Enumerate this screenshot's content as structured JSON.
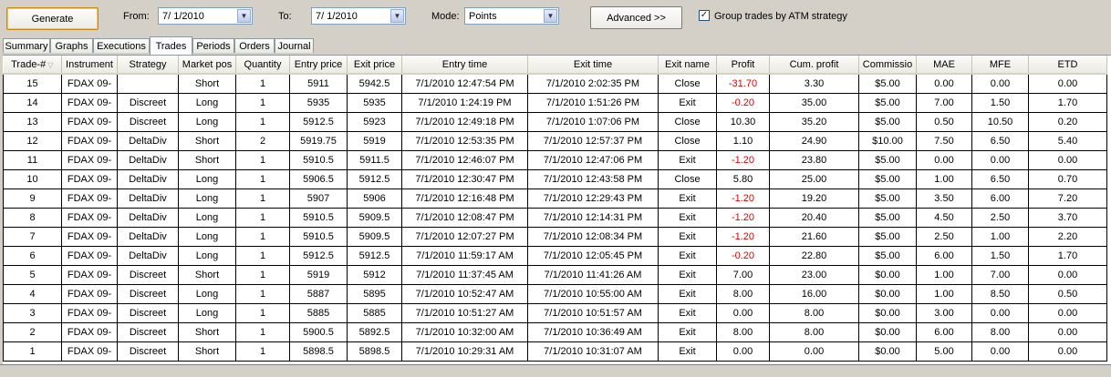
{
  "toolbar": {
    "generate_label": "Generate",
    "from_label": "From:",
    "from_value": "7/ 1/2010",
    "to_label": "To:",
    "to_value": "7/ 1/2010",
    "mode_label": "Mode:",
    "mode_value": "Points",
    "advanced_label": "Advanced >>",
    "group_checkbox_label": "Group trades by ATM strategy",
    "group_checked": "✓"
  },
  "tabs": [
    "Summary",
    "Graphs",
    "Executions",
    "Trades",
    "Periods",
    "Orders",
    "Journal"
  ],
  "active_tab": "Trades",
  "table": {
    "columns": [
      "Trade-#",
      "Instrument",
      "Strategy",
      "Market pos",
      "Quantity",
      "Entry price",
      "Exit price",
      "Entry time",
      "Exit time",
      "Exit name",
      "Profit",
      "Cum. profit",
      "Commissio",
      "MAE",
      "MFE",
      "ETD"
    ],
    "rows": [
      [
        "15",
        "FDAX 09-",
        "",
        "Short",
        "1",
        "5911",
        "5942.5",
        "7/1/2010 12:47:54 PM",
        "7/1/2010 2:02:35 PM",
        "Close",
        "-31.70",
        "3.30",
        "$5.00",
        "0.00",
        "0.00",
        "0.00"
      ],
      [
        "14",
        "FDAX 09-",
        "Discreet",
        "Long",
        "1",
        "5935",
        "5935",
        "7/1/2010 1:24:19 PM",
        "7/1/2010 1:51:26 PM",
        "Exit",
        "-0.20",
        "35.00",
        "$5.00",
        "7.00",
        "1.50",
        "1.70"
      ],
      [
        "13",
        "FDAX 09-",
        "Discreet",
        "Long",
        "1",
        "5912.5",
        "5923",
        "7/1/2010 12:49:18 PM",
        "7/1/2010 1:07:06 PM",
        "Close",
        "10.30",
        "35.20",
        "$5.00",
        "0.50",
        "10.50",
        "0.20"
      ],
      [
        "12",
        "FDAX 09-",
        "DeltaDiv",
        "Short",
        "2",
        "5919.75",
        "5919",
        "7/1/2010 12:53:35 PM",
        "7/1/2010 12:57:37 PM",
        "Close",
        "1.10",
        "24.90",
        "$10.00",
        "7.50",
        "6.50",
        "5.40"
      ],
      [
        "11",
        "FDAX 09-",
        "DeltaDiv",
        "Short",
        "1",
        "5910.5",
        "5911.5",
        "7/1/2010 12:46:07 PM",
        "7/1/2010 12:47:06 PM",
        "Exit",
        "-1.20",
        "23.80",
        "$5.00",
        "0.00",
        "0.00",
        "0.00"
      ],
      [
        "10",
        "FDAX 09-",
        "DeltaDiv",
        "Long",
        "1",
        "5906.5",
        "5912.5",
        "7/1/2010 12:30:47 PM",
        "7/1/2010 12:43:58 PM",
        "Close",
        "5.80",
        "25.00",
        "$5.00",
        "1.00",
        "6.50",
        "0.70"
      ],
      [
        "9",
        "FDAX 09-",
        "DeltaDiv",
        "Long",
        "1",
        "5907",
        "5906",
        "7/1/2010 12:16:48 PM",
        "7/1/2010 12:29:43 PM",
        "Exit",
        "-1.20",
        "19.20",
        "$5.00",
        "3.50",
        "6.00",
        "7.20"
      ],
      [
        "8",
        "FDAX 09-",
        "DeltaDiv",
        "Long",
        "1",
        "5910.5",
        "5909.5",
        "7/1/2010 12:08:47 PM",
        "7/1/2010 12:14:31 PM",
        "Exit",
        "-1.20",
        "20.40",
        "$5.00",
        "4.50",
        "2.50",
        "3.70"
      ],
      [
        "7",
        "FDAX 09-",
        "DeltaDiv",
        "Long",
        "1",
        "5910.5",
        "5909.5",
        "7/1/2010 12:07:27 PM",
        "7/1/2010 12:08:34 PM",
        "Exit",
        "-1.20",
        "21.60",
        "$5.00",
        "2.50",
        "1.00",
        "2.20"
      ],
      [
        "6",
        "FDAX 09-",
        "DeltaDiv",
        "Long",
        "1",
        "5912.5",
        "5912.5",
        "7/1/2010 11:59:17 AM",
        "7/1/2010 12:05:45 PM",
        "Exit",
        "-0.20",
        "22.80",
        "$5.00",
        "6.00",
        "1.50",
        "1.70"
      ],
      [
        "5",
        "FDAX 09-",
        "Discreet",
        "Short",
        "1",
        "5919",
        "5912",
        "7/1/2010 11:37:45 AM",
        "7/1/2010 11:41:26 AM",
        "Exit",
        "7.00",
        "23.00",
        "$0.00",
        "1.00",
        "7.00",
        "0.00"
      ],
      [
        "4",
        "FDAX 09-",
        "Discreet",
        "Long",
        "1",
        "5887",
        "5895",
        "7/1/2010 10:52:47 AM",
        "7/1/2010 10:55:00 AM",
        "Exit",
        "8.00",
        "16.00",
        "$0.00",
        "1.00",
        "8.50",
        "0.50"
      ],
      [
        "3",
        "FDAX 09-",
        "Discreet",
        "Long",
        "1",
        "5885",
        "5885",
        "7/1/2010 10:51:27 AM",
        "7/1/2010 10:51:57 AM",
        "Exit",
        "0.00",
        "8.00",
        "$0.00",
        "3.00",
        "0.00",
        "0.00"
      ],
      [
        "2",
        "FDAX 09-",
        "Discreet",
        "Short",
        "1",
        "5900.5",
        "5892.5",
        "7/1/2010 10:32:00 AM",
        "7/1/2010 10:36:49 AM",
        "Exit",
        "8.00",
        "8.00",
        "$0.00",
        "6.00",
        "8.00",
        "0.00"
      ],
      [
        "1",
        "FDAX 09-",
        "Discreet",
        "Short",
        "1",
        "5898.5",
        "5898.5",
        "7/1/2010 10:29:31 AM",
        "7/1/2010 10:31:07 AM",
        "Exit",
        "0.00",
        "0.00",
        "$0.00",
        "5.00",
        "0.00",
        "0.00"
      ]
    ]
  },
  "colors": {
    "negative_profit": "#e00000",
    "accent_button_border": "#c98a15"
  }
}
